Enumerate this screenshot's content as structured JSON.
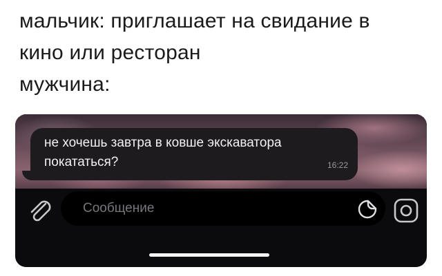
{
  "caption": {
    "lines": [
      "мальчик: приглашает на свидание в",
      "кино или ресторан",
      "мужчина:"
    ]
  },
  "chat": {
    "message": {
      "lines": [
        "не хочешь завтра в ковше экскаватора",
        "покататься?"
      ],
      "time": "16:22"
    },
    "input": {
      "placeholder": "Сообщение"
    },
    "icons": {
      "attach": "paperclip-icon",
      "sticker": "sticker-icon",
      "camera": "camera-icon"
    }
  }
}
